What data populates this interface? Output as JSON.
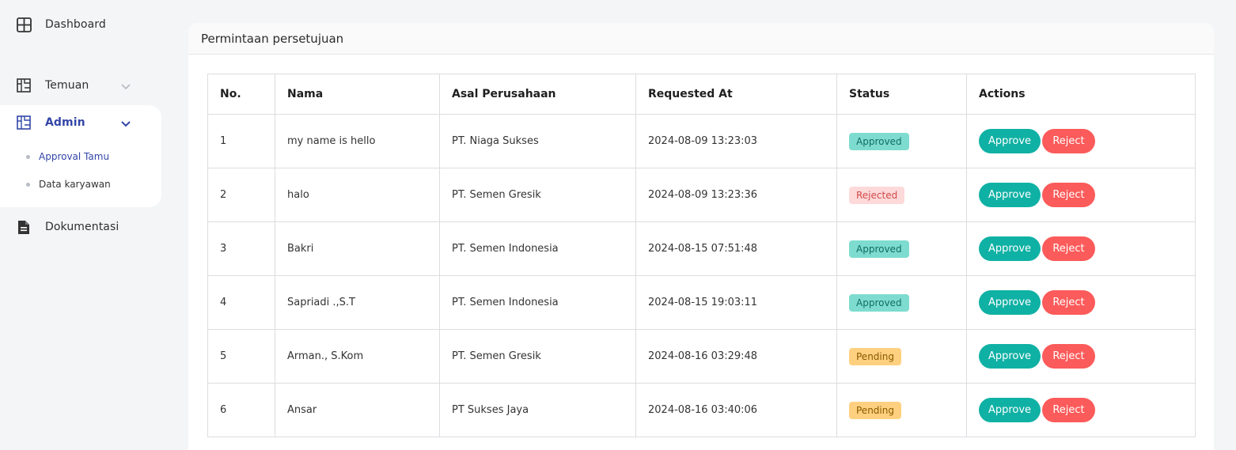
{
  "sidebar": {
    "items": [
      {
        "label": "Dashboard",
        "icon": "grid-icon"
      },
      {
        "label": "Temuan",
        "icon": "floorplan-icon"
      },
      {
        "label": "Admin",
        "icon": "floorplan-icon"
      },
      {
        "label": "Dokumentasi",
        "icon": "document-icon"
      }
    ],
    "admin_sub": [
      {
        "label": "Approval Tamu"
      },
      {
        "label": "Data karyawan"
      }
    ],
    "accent": "#3346a8"
  },
  "card": {
    "title": "Permintaan persetujuan"
  },
  "table": {
    "headers": [
      "No.",
      "Nama",
      "Asal Perusahaan",
      "Requested At",
      "Status",
      "Actions"
    ],
    "rows": [
      {
        "no": "1",
        "nama": "my name is hello",
        "asal": "PT. Niaga Sukses",
        "requested": "2024-08-09 13:23:03",
        "status": "Approved",
        "status_kind": "approved"
      },
      {
        "no": "2",
        "nama": "halo",
        "asal": "PT. Semen Gresik",
        "requested": "2024-08-09 13:23:36",
        "status": "Rejected",
        "status_kind": "rejected"
      },
      {
        "no": "3",
        "nama": "Bakri",
        "asal": "PT. Semen Indonesia",
        "requested": "2024-08-15 07:51:48",
        "status": "Approved",
        "status_kind": "approved"
      },
      {
        "no": "4",
        "nama": "Sapriadi .,S.T",
        "asal": "PT. Semen Indonesia",
        "requested": "2024-08-15 19:03:11",
        "status": "Approved",
        "status_kind": "approved"
      },
      {
        "no": "5",
        "nama": "Arman., S.Kom",
        "asal": "PT. Semen Gresik",
        "requested": "2024-08-16 03:29:48",
        "status": "Pending",
        "status_kind": "pending"
      },
      {
        "no": "6",
        "nama": "Ansar",
        "asal": "PT Sukses Jaya",
        "requested": "2024-08-16 03:40:06",
        "status": "Pending",
        "status_kind": "pending"
      }
    ],
    "approve_label": "Approve",
    "reject_label": "Reject"
  },
  "colors": {
    "approve": "#0fb1a4",
    "reject": "#fb5b5a",
    "approved_badge": "#7ddccf",
    "rejected_badge": "#fdd9d9",
    "pending_badge": "#ffd07f"
  }
}
